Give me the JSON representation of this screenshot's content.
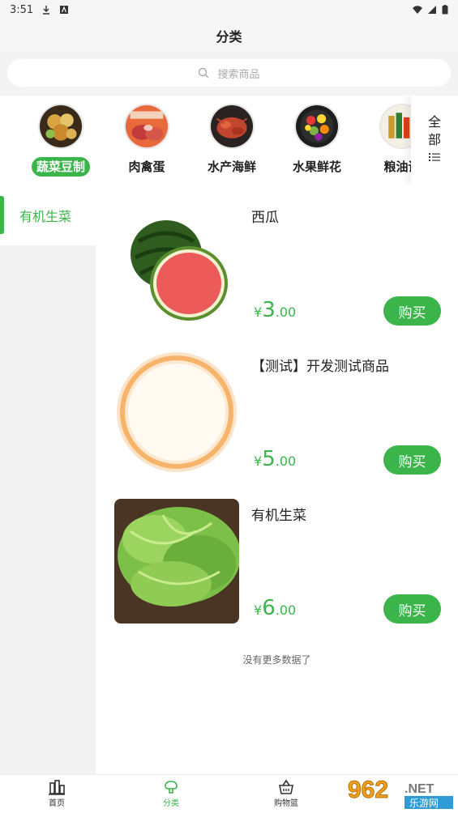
{
  "status_bar": {
    "time": "3:51"
  },
  "header": {
    "title": "分类"
  },
  "search": {
    "placeholder": "搜索商品"
  },
  "categories": [
    {
      "label": "蔬菜豆制",
      "icon": "vegetables-platter-image",
      "active": true
    },
    {
      "label": "肉禽蛋",
      "icon": "meat-image",
      "active": false
    },
    {
      "label": "水产海鲜",
      "icon": "seafood-image",
      "active": false
    },
    {
      "label": "水果鲜花",
      "icon": "fruit-flower-image",
      "active": false
    },
    {
      "label": "粮油调",
      "icon": "grain-oil-image",
      "active": false
    }
  ],
  "all_button": {
    "line1": "全",
    "line2": "部"
  },
  "sidebar": {
    "items": [
      {
        "label": "有机生菜",
        "active": true
      }
    ]
  },
  "products": [
    {
      "name": "西瓜",
      "currency": "¥",
      "price_int": "3",
      "price_dec": ".00",
      "buy": "购买",
      "image": "watermelon-image"
    },
    {
      "name": "【测试】开发测试商品",
      "currency": "¥",
      "price_int": "5",
      "price_dec": ".00",
      "buy": "购买",
      "image": "test-product-image"
    },
    {
      "name": "有机生菜",
      "currency": "¥",
      "price_int": "6",
      "price_dec": ".00",
      "buy": "购买",
      "image": "lettuce-image"
    }
  ],
  "list_footer": "没有更多数据了",
  "tabbar": {
    "items": [
      {
        "label": "首页",
        "icon": "home-icon"
      },
      {
        "label": "分类",
        "icon": "category-icon",
        "active": true
      },
      {
        "label": "购物篮",
        "icon": "basket-icon"
      }
    ]
  },
  "watermark": {
    "text": "962.NET",
    "sub": "乐游网"
  },
  "colors": {
    "accent": "#3bb54a",
    "background": "#f6f6f6",
    "sidebar_bg": "#f2f2f2"
  }
}
